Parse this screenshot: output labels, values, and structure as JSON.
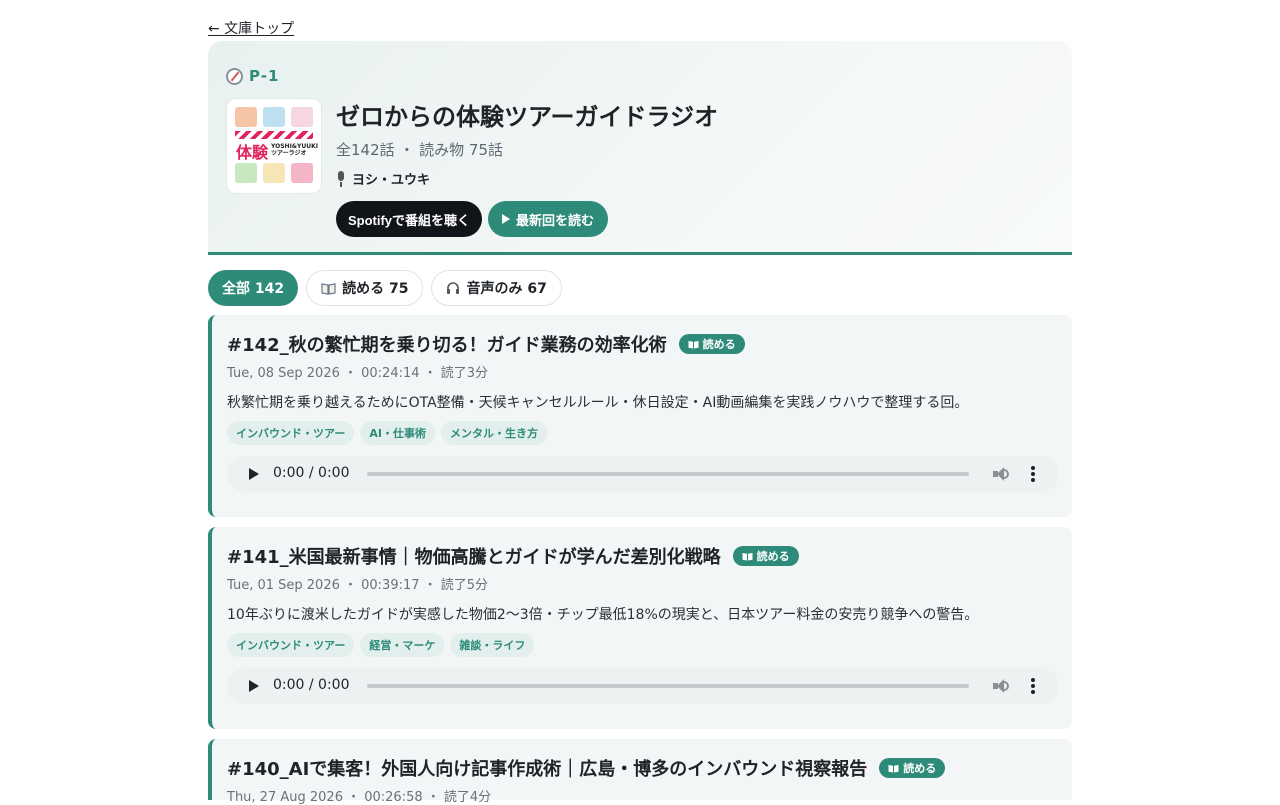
{
  "nav": {
    "back_label": "← 文庫トップ"
  },
  "program": {
    "code": "P-1",
    "title": "ゼロからの体験ツアーガイドラジオ",
    "meta": "全142話 ・ 読み物 75話",
    "host": "ヨシ・ユウキ",
    "cover": {
      "main_text": "体験",
      "sub_text": "YOSHI&YUUKI ツアーラジオ"
    },
    "spotify_button": "Spotifyで番組を聴く",
    "latest_button": "最新回を読む"
  },
  "filters": [
    {
      "label": "全部 142",
      "active": true,
      "icon": ""
    },
    {
      "label": "読める 75",
      "active": false,
      "icon": "book-icon"
    },
    {
      "label": "音声のみ 67",
      "active": false,
      "icon": "headphones-icon"
    }
  ],
  "episodes": [
    {
      "title": "#142_秋の繁忙期を乗り切る！ガイド業務の効率化術",
      "badge": "読める",
      "meta": "Tue, 08 Sep 2026 ・ 00:24:14 ・ 読了3分",
      "description": "秋繁忙期を乗り越えるためにOTA整備・天候キャンセルルール・休日設定・AI動画編集を実践ノウハウで整理する回。",
      "tags": [
        "インバウンド・ツアー",
        "AI・仕事術",
        "メンタル・生き方"
      ],
      "audio_time": "0:00 / 0:00"
    },
    {
      "title": "#141_米国最新事情｜物価高騰とガイドが学んだ差別化戦略",
      "badge": "読める",
      "meta": "Tue, 01 Sep 2026 ・ 00:39:17 ・ 読了5分",
      "description": "10年ぶりに渡米したガイドが実感した物価2〜3倍・チップ最低18%の現実と、日本ツアー料金の安売り競争への警告。",
      "tags": [
        "インバウンド・ツアー",
        "経営・マーケ",
        "雑談・ライフ"
      ],
      "audio_time": "0:00 / 0:00"
    },
    {
      "title": "#140_AIで集客！外国人向け記事作成術｜広島・博多のインバウンド視察報告",
      "badge": "読める",
      "meta": "Thu, 27 Aug 2026 ・ 00:26:58 ・ 読了4分"
    }
  ],
  "colors": {
    "accent": "#2e8b7a",
    "dark": "#111418",
    "card_bg": "#f3f6f7"
  }
}
